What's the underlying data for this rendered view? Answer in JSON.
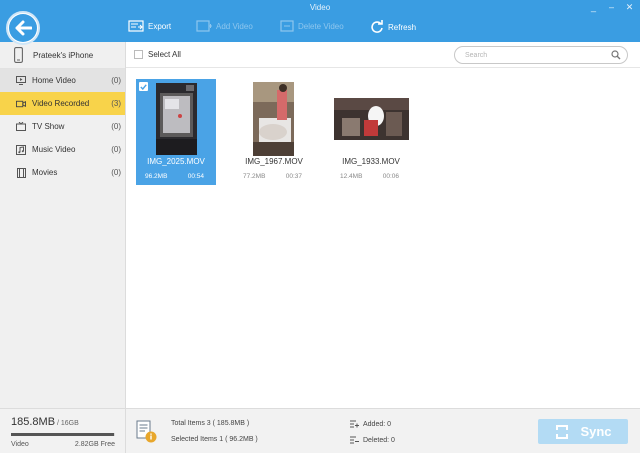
{
  "window": {
    "title": "Video",
    "controls": [
      "_",
      "–",
      "✕"
    ]
  },
  "toolbar": {
    "export_label": "Export",
    "add_label": "Add Video",
    "delete_label": "Delete Video",
    "refresh_label": "Refresh"
  },
  "sidebar": {
    "device_name": "Prateek's iPhone",
    "items": [
      {
        "label": "Home Video",
        "count": "(0)",
        "icon": "home-video-icon"
      },
      {
        "label": "Video Recorded",
        "count": "(3)",
        "icon": "camera-icon"
      },
      {
        "label": "TV Show",
        "count": "(0)",
        "icon": "tv-icon"
      },
      {
        "label": "Music Video",
        "count": "(0)",
        "icon": "music-video-icon"
      },
      {
        "label": "Movies",
        "count": "(0)",
        "icon": "film-icon"
      }
    ]
  },
  "main": {
    "select_all_label": "Select All",
    "search_placeholder": "Search",
    "videos": [
      {
        "name": "IMG_2025.MOV",
        "size": "96.2MB",
        "duration": "00:54",
        "selected": true
      },
      {
        "name": "IMG_1967.MOV",
        "size": "77.2MB",
        "duration": "00:37",
        "selected": false
      },
      {
        "name": "IMG_1933.MOV",
        "size": "12.4MB",
        "duration": "00:06",
        "selected": false
      }
    ]
  },
  "storage": {
    "used": "185.8MB",
    "total": " / 16GB",
    "label": "Video",
    "free": "2.82GB Free",
    "fill_fraction": 0.99
  },
  "summary": {
    "total_items": "Total Items  3  ( 185.8MB )",
    "selected_items": "Selected Items  1  ( 96.2MB )",
    "added": "Added: 0",
    "deleted": "Deleted: 0"
  },
  "sync_label": "Sync",
  "colors": {
    "accent": "#3a9de2",
    "active_category": "#f8d34a",
    "selected_tile": "#4aa3e6"
  }
}
